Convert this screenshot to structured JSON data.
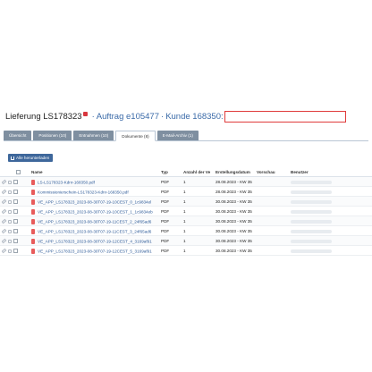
{
  "header": {
    "title": "Lieferung LS178323",
    "order_link": "Auftrag e105477",
    "separator": "·",
    "customer_link": "Kunde 168350:"
  },
  "tabs": [
    {
      "label": "Übersicht",
      "active": false
    },
    {
      "label": "Positionen (10)",
      "active": false
    },
    {
      "label": "Entnahmen (10)",
      "active": false
    },
    {
      "label": "Dokumente (8)",
      "active": true
    },
    {
      "label": "E-Mail-Archiv (1)",
      "active": false
    }
  ],
  "toolbar": {
    "download_all_label": "Alle herunterladen"
  },
  "columns": {
    "name": "Name",
    "type": "Typ",
    "count": "Anzahl der Ver",
    "date": "Erstellungsdatum",
    "preview": "Vorschau",
    "user": "Benutzer"
  },
  "documents": [
    {
      "name": "LS-LS178323-Kdnr-168350.pdf",
      "type": "PDF",
      "count": "1",
      "date": "28.08.2023 - KW 35"
    },
    {
      "name": "Kommissionierschein-LS178323-Kdnr-168350.pdf",
      "type": "PDF",
      "count": "1",
      "date": "28.08.2023 - KW 35"
    },
    {
      "name": "VE_APP_LS178323_2023-08-30T07-19-10CEST_0_1c9834el",
      "type": "PDF",
      "count": "1",
      "date": "30.08.2023 - KW 35"
    },
    {
      "name": "VE_APP_LS178323_2023-08-30T07-19-10CEST_1_1c9834eb",
      "type": "PDF",
      "count": "1",
      "date": "30.08.2023 - KW 35"
    },
    {
      "name": "VE_APP_LS178323_2023-08-30T07-19-11CEST_2_24f65ad6",
      "type": "PDF",
      "count": "1",
      "date": "30.08.2023 - KW 35"
    },
    {
      "name": "VE_APP_LS178323_2023-08-30T07-19-11CEST_3_24f65ad6",
      "type": "PDF",
      "count": "1",
      "date": "30.08.2023 - KW 35"
    },
    {
      "name": "VE_APP_LS178323_2023-08-30T07-19-12CEST_4_3169af91",
      "type": "PDF",
      "count": "1",
      "date": "30.08.2023 - KW 35"
    },
    {
      "name": "VE_APP_LS178323_2023-08-30T07-19-12CEST_5_3169af91",
      "type": "PDF",
      "count": "1",
      "date": "30.08.2023 - KW 35"
    }
  ],
  "icons": {
    "edit": "pencil-icon",
    "lock": "lock-icon",
    "file": "pdf-file-icon",
    "download": "download-icon"
  },
  "colors": {
    "accent": "#3e679b",
    "link": "#3a6aa8",
    "alert": "#e03c3c",
    "tab_inactive": "#7f8fa0"
  }
}
